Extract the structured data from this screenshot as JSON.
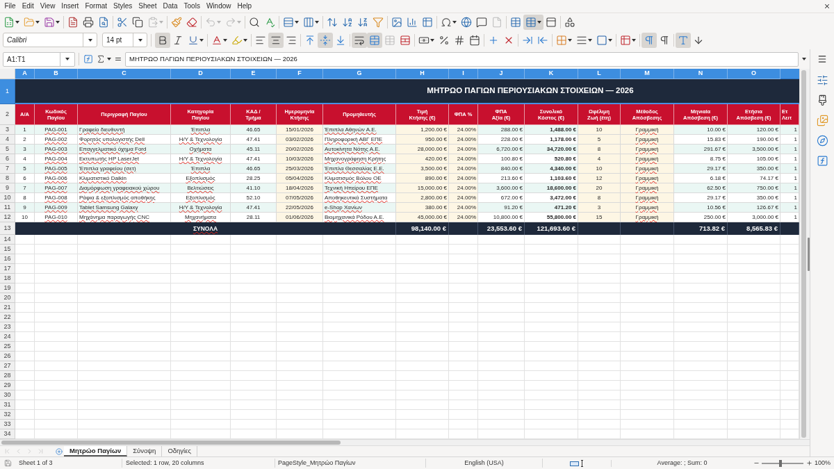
{
  "menu_bar": {
    "items": [
      "File",
      "Edit",
      "View",
      "Insert",
      "Format",
      "Styles",
      "Sheet",
      "Data",
      "Tools",
      "Window",
      "Help"
    ]
  },
  "standard_toolbar": {
    "groups": [
      [
        {
          "dropdown": true,
          "pressed": false,
          "disabled": false
        },
        {
          "dropdown": true,
          "pressed": false,
          "disabled": false
        },
        {
          "dropdown": true,
          "pressed": false,
          "disabled": false
        }
      ],
      [
        {
          "dropdown": false,
          "pressed": false,
          "disabled": false
        },
        {
          "dropdown": false,
          "pressed": false,
          "disabled": false
        },
        {
          "dropdown": false,
          "pressed": false,
          "disabled": false
        }
      ],
      [
        {
          "dropdown": false,
          "pressed": false,
          "disabled": false
        },
        {
          "dropdown": false,
          "pressed": false,
          "disabled": false
        },
        {
          "dropdown": true,
          "pressed": false,
          "disabled": true
        }
      ],
      [
        {
          "dropdown": false,
          "pressed": false,
          "disabled": false
        },
        {
          "dropdown": false,
          "pressed": false,
          "disabled": false
        }
      ],
      [
        {
          "dropdown": true,
          "pressed": false,
          "disabled": true
        },
        {
          "dropdown": true,
          "pressed": false,
          "disabled": true
        }
      ],
      [
        {
          "dropdown": false,
          "pressed": false,
          "disabled": false
        },
        {
          "dropdown": false,
          "pressed": false,
          "disabled": false
        }
      ],
      [
        {
          "dropdown": true,
          "pressed": false,
          "disabled": false
        },
        {
          "dropdown": true,
          "pressed": false,
          "disabled": false
        }
      ],
      [
        {
          "dropdown": false,
          "pressed": false,
          "disabled": false
        },
        {
          "dropdown": false,
          "pressed": false,
          "disabled": false
        },
        {
          "dropdown": false,
          "pressed": false,
          "disabled": false
        },
        {
          "dropdown": false,
          "pressed": false,
          "disabled": false
        }
      ],
      [
        {
          "dropdown": false,
          "pressed": false,
          "disabled": false
        },
        {
          "dropdown": false,
          "pressed": false,
          "disabled": false
        },
        {
          "dropdown": false,
          "pressed": false,
          "disabled": false
        }
      ],
      [
        {
          "dropdown": true,
          "pressed": false,
          "disabled": false
        },
        {
          "dropdown": false,
          "pressed": false,
          "disabled": false
        },
        {
          "dropdown": false,
          "pressed": false,
          "disabled": false
        },
        {
          "dropdown": false,
          "pressed": false,
          "disabled": true
        }
      ],
      [
        {
          "dropdown": false,
          "pressed": false,
          "disabled": false
        },
        {
          "dropdown": true,
          "pressed": true,
          "disabled": false
        },
        {
          "dropdown": false,
          "pressed": false,
          "disabled": false
        }
      ],
      [
        {
          "dropdown": false,
          "pressed": false,
          "disabled": false
        }
      ]
    ]
  },
  "formatting_toolbar": {
    "font_name": "Calibri",
    "font_size": "14 pt",
    "groups": [
      [
        {
          "dropdown": false,
          "pressed": true,
          "disabled": false
        },
        {
          "dropdown": false,
          "pressed": false,
          "disabled": false
        },
        {
          "dropdown": true,
          "pressed": false,
          "disabled": false
        }
      ],
      [
        {
          "dropdown": true,
          "pressed": false,
          "disabled": false
        },
        {
          "dropdown": true,
          "pressed": false,
          "disabled": false
        }
      ],
      [
        {
          "dropdown": false,
          "pressed": false,
          "disabled": false
        },
        {
          "dropdown": false,
          "pressed": true,
          "disabled": false
        },
        {
          "dropdown": false,
          "pressed": false,
          "disabled": false
        }
      ],
      [
        {
          "dropdown": false,
          "pressed": false,
          "disabled": false
        },
        {
          "dropdown": false,
          "pressed": true,
          "disabled": false
        },
        {
          "dropdown": false,
          "pressed": false,
          "disabled": false
        }
      ],
      [
        {
          "dropdown": false,
          "pressed": true,
          "disabled": false
        },
        {
          "dropdown": false,
          "pressed": true,
          "disabled": false
        },
        {
          "dropdown": false,
          "pressed": false,
          "disabled": true
        },
        {
          "dropdown": false,
          "pressed": false,
          "disabled": false
        }
      ],
      [
        {
          "dropdown": true,
          "pressed": false,
          "disabled": false
        },
        {
          "dropdown": false,
          "pressed": false,
          "disabled": false
        },
        {
          "dropdown": false,
          "pressed": false,
          "disabled": false
        },
        {
          "dropdown": false,
          "pressed": false,
          "disabled": false
        }
      ],
      [
        {
          "dropdown": false,
          "pressed": false,
          "disabled": false
        },
        {
          "dropdown": false,
          "pressed": false,
          "disabled": false
        }
      ],
      [
        {
          "dropdown": false,
          "pressed": false,
          "disabled": false
        },
        {
          "dropdown": false,
          "pressed": false,
          "disabled": false
        }
      ],
      [
        {
          "dropdown": true,
          "pressed": false,
          "disabled": false
        },
        {
          "dropdown": true,
          "pressed": false,
          "disabled": false
        },
        {
          "dropdown": true,
          "pressed": false,
          "disabled": false
        }
      ],
      [
        {
          "dropdown": true,
          "pressed": false,
          "disabled": false
        }
      ],
      [
        {
          "dropdown": false,
          "pressed": true,
          "disabled": false
        },
        {
          "dropdown": false,
          "pressed": false,
          "disabled": false
        }
      ],
      [
        {
          "dropdown": false,
          "pressed": true,
          "disabled": false
        },
        {
          "dropdown": false,
          "pressed": false,
          "disabled": false
        }
      ]
    ]
  },
  "formula_bar": {
    "name_box": "A1:T1",
    "content": "ΜΗΤΡΩΟ ΠΑΓΙΩΝ ΠΕΡΙΟΥΣΙΑΚΩΝ ΣΤΟΙΧΕΙΩΝ — 2026"
  },
  "sheet": {
    "column_headers": [
      {
        "label": "A",
        "selected": true
      },
      {
        "label": "B",
        "selected": true
      },
      {
        "label": "C",
        "selected": true
      },
      {
        "label": "D",
        "selected": true
      },
      {
        "label": "E",
        "selected": true
      },
      {
        "label": "F",
        "selected": true
      },
      {
        "label": "G",
        "selected": true
      },
      {
        "label": "H",
        "selected": true
      },
      {
        "label": "I",
        "selected": true
      },
      {
        "label": "J",
        "selected": true
      },
      {
        "label": "K",
        "selected": true
      },
      {
        "label": "L",
        "selected": true
      },
      {
        "label": "M",
        "selected": true
      },
      {
        "label": "N",
        "selected": true
      },
      {
        "label": "O",
        "selected": true
      }
    ],
    "title_row": {
      "header": {
        "label": "1",
        "selected": true
      },
      "title": "ΜΗΤΡΩΟ ΠΑΓΙΩΝ ΠΕΡΙΟΥΣΙΑΚΩΝ ΣΤΟΙΧΕΙΩΝ — 2026"
    },
    "heading_row": {
      "header": {
        "label": "2",
        "selected": false
      },
      "headings": [
        "Α/Α",
        "Κωδικός\nΠαγίου",
        "Περιγραφή Παγίου",
        "Κατηγορία\nΠαγίου",
        "ΚΑΔ /\nΤμήμα",
        "Ημερομηνία\nΚτήσης",
        "Προμηθευτής",
        "Τιμή\nΚτήσης (€)",
        "ΦΠΑ %",
        "ΦΠΑ\nΑξία (€)",
        "Συνολικό\nΚόστος (€)",
        "Ωφέλιμη\nΖωή (έτη)",
        "Μέθοδος\nΑπόσβεσης",
        "Μηνιαία\nΑπόσβεση (€)",
        "Ετήσια\nΑπόσβεση (€)",
        "Ετ\nΛειτ"
      ]
    },
    "rows": [
      {
        "header": {
          "label": "3",
          "selected": false
        },
        "cells": [
          "1",
          "PAG-001",
          "Γραφείο διευθυντή",
          "Έπιπλα",
          "46.65",
          "15/01/2026",
          "Έπιπλα Αθηνών Α.Ε.",
          "1,200.00 €",
          "24.00%",
          "288.00 €",
          "1,488.00 €",
          "10",
          "Γραμμική",
          "10.00 €",
          "120.00 €",
          "1"
        ]
      },
      {
        "header": {
          "label": "4",
          "selected": false
        },
        "cells": [
          "2",
          "PAG-002",
          "Φορητός υπολογιστής Dell",
          "Η/Υ & Τεχνολογία",
          "47.41",
          "03/02/2026",
          "Πληροφορική ΑΒΓ ΕΠΕ",
          "950.00 €",
          "24.00%",
          "228.00 €",
          "1,178.00 €",
          "5",
          "Γραμμική",
          "15.83 €",
          "190.00 €",
          "1"
        ]
      },
      {
        "header": {
          "label": "5",
          "selected": false
        },
        "cells": [
          "3",
          "PAG-003",
          "Επαγγελματικό όχημα Ford",
          "Οχήματα",
          "45.11",
          "20/02/2026",
          "Αυτοκίνητα Νότης Α.Ε.",
          "28,000.00 €",
          "24.00%",
          "6,720.00 €",
          "34,720.00 €",
          "8",
          "Γραμμική",
          "291.67 €",
          "3,500.00 €",
          "1"
        ]
      },
      {
        "header": {
          "label": "6",
          "selected": false
        },
        "cells": [
          "4",
          "PAG-004",
          "Εκτυπωτής HP LaserJet",
          "Η/Υ & Τεχνολογία",
          "47.41",
          "10/03/2026",
          "Μηχανογράφηση Κρήτης",
          "420.00 €",
          "24.00%",
          "100.80 €",
          "520.80 €",
          "4",
          "Γραμμική",
          "8.75 €",
          "105.00 €",
          "1"
        ]
      },
      {
        "header": {
          "label": "7",
          "selected": false
        },
        "cells": [
          "5",
          "PAG-005",
          "Έπιπλα γραφείου (σετ)",
          "Έπιπλα",
          "46.65",
          "25/03/2026",
          "Έπιπλα Θεσσαλίας Ε.Ε.",
          "3,500.00 €",
          "24.00%",
          "840.00 €",
          "4,340.00 €",
          "10",
          "Γραμμική",
          "29.17 €",
          "350.00 €",
          "1"
        ]
      },
      {
        "header": {
          "label": "8",
          "selected": false
        },
        "cells": [
          "6",
          "PAG-006",
          "Κλιματιστικό Daikin",
          "Εξοπλισμός",
          "28.25",
          "05/04/2026",
          "Κλιματισμός Βόλου ΟΕ",
          "890.00 €",
          "24.00%",
          "213.60 €",
          "1,103.60 €",
          "12",
          "Γραμμική",
          "6.18 €",
          "74.17 €",
          "1"
        ]
      },
      {
        "header": {
          "label": "9",
          "selected": false
        },
        "cells": [
          "7",
          "PAG-007",
          "Διαμόρφωση γραφειακού χώρου",
          "Βελτιώσεις",
          "41.10",
          "18/04/2026",
          "Τεχνική Ηπείρου ΕΠΕ",
          "15,000.00 €",
          "24.00%",
          "3,600.00 €",
          "18,600.00 €",
          "20",
          "Γραμμική",
          "62.50 €",
          "750.00 €",
          "1"
        ]
      },
      {
        "header": {
          "label": "10",
          "selected": false
        },
        "cells": [
          "8",
          "PAG-008",
          "Ράφια & εξοπλισμός αποθήκης",
          "Εξοπλισμός",
          "52.10",
          "07/05/2026",
          "Αποθηκευτικά Συστήματα",
          "2,800.00 €",
          "24.00%",
          "672.00 €",
          "3,472.00 €",
          "8",
          "Γραμμική",
          "29.17 €",
          "350.00 €",
          "1"
        ]
      },
      {
        "header": {
          "label": "11",
          "selected": false
        },
        "cells": [
          "9",
          "PAG-009",
          "Tablet Samsung Galaxy",
          "Η/Υ & Τεχνολογία",
          "47.41",
          "22/05/2026",
          "e-Shop Χανίων",
          "380.00 €",
          "24.00%",
          "91.20 €",
          "471.20 €",
          "3",
          "Γραμμική",
          "10.56 €",
          "126.67 €",
          "1"
        ]
      },
      {
        "header": {
          "label": "12",
          "selected": false
        },
        "cells": [
          "10",
          "PAG-010",
          "Μηχάνημα παραγωγής CNC",
          "Μηχανήματα",
          "28.11",
          "01/06/2026",
          "Βιομηχανικά Ρόδου Α.Ε.",
          "45,000.00 €",
          "24.00%",
          "10,800.00 €",
          "55,800.00 €",
          "15",
          "Γραμμική",
          "250.00 €",
          "3,000.00 €",
          "1"
        ]
      }
    ],
    "totals_row": {
      "header": {
        "label": "13",
        "selected": false
      },
      "label": "ΣΥΝΟΛΑ",
      "values": {
        "H": "98,140.00 €",
        "J": "23,553.60 €",
        "K": "121,693.60 €",
        "N": "713.82 €",
        "O": "8,565.83 €"
      }
    },
    "empty_rows": [
      {
        "label": "14",
        "selected": false
      },
      {
        "label": "15",
        "selected": false
      },
      {
        "label": "16",
        "selected": false
      },
      {
        "label": "17",
        "selected": false
      },
      {
        "label": "18",
        "selected": false
      },
      {
        "label": "19",
        "selected": false
      },
      {
        "label": "20",
        "selected": false
      },
      {
        "label": "21",
        "selected": false
      },
      {
        "label": "22",
        "selected": false
      },
      {
        "label": "23",
        "selected": false
      },
      {
        "label": "24",
        "selected": false
      },
      {
        "label": "25",
        "selected": false
      },
      {
        "label": "26",
        "selected": false
      },
      {
        "label": "27",
        "selected": false
      },
      {
        "label": "28",
        "selected": false
      },
      {
        "label": "29",
        "selected": false
      },
      {
        "label": "30",
        "selected": false
      },
      {
        "label": "31",
        "selected": false
      },
      {
        "label": "32",
        "selected": false
      },
      {
        "label": "33",
        "selected": false
      },
      {
        "label": "34",
        "selected": false
      }
    ]
  },
  "sheet_tabs": {
    "nav_buttons": [
      {
        "disabled": true
      },
      {
        "disabled": true
      },
      {
        "disabled": true
      },
      {
        "disabled": true
      }
    ],
    "tabs": [
      {
        "label": "Μητρώο Παγίων",
        "selected": true
      },
      {
        "label": "Σύνοψη",
        "selected": false
      },
      {
        "label": "Οδηγίες",
        "selected": false
      }
    ]
  },
  "status_bar": {
    "sheet_info": "Sheet 1 of 3",
    "selection": "Selected: 1 row, 20 columns",
    "page_style": "PageStyle_Μητρώο Παγίων",
    "language": "English (USA)",
    "summary": "Average: ; Sum: 0",
    "zoom": {
      "level": 0.45,
      "percent": "100%"
    }
  }
}
